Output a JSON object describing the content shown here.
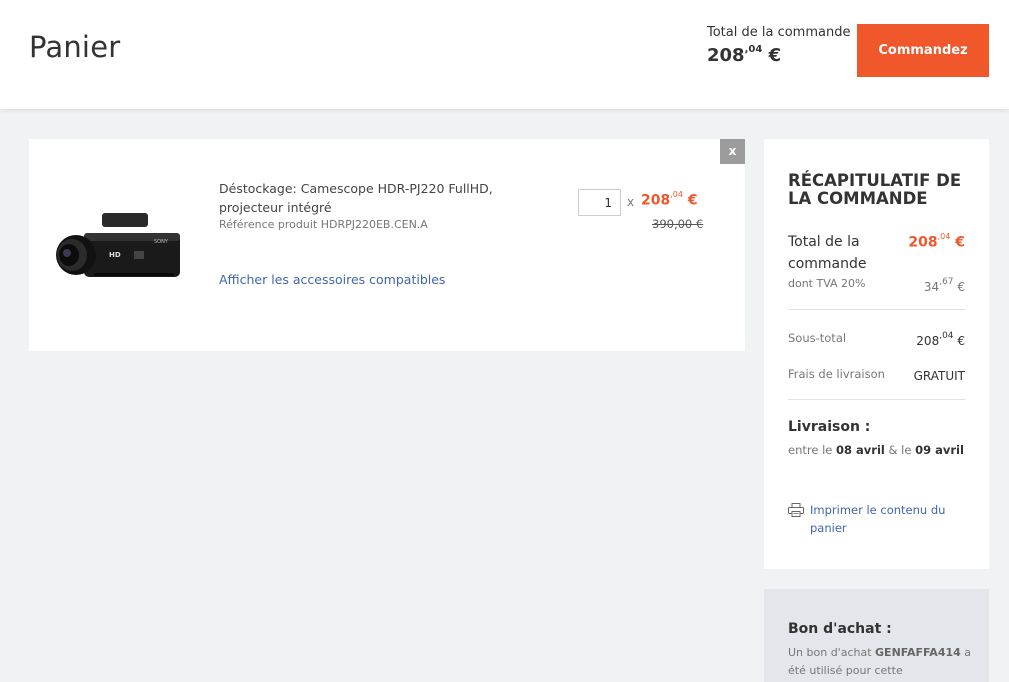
{
  "header": {
    "title": "Panier",
    "total_label": "Total de la commande",
    "total_int": "208",
    "total_dec": ",04",
    "total_currency": "€",
    "order_button": "Commandez"
  },
  "cart": {
    "remove_label": "x",
    "item": {
      "title": "Déstockage: Camescope HDR-PJ220 FullHD, projecteur intégré",
      "reference": "Référence produit HDRPJ220EB.CEN.A",
      "accessories_link": "Afficher les accessoires compatibles",
      "quantity": "1",
      "times": "x",
      "price_int": "208",
      "price_dec": ",04",
      "price_currency": "€",
      "old_price": "390,00 €"
    }
  },
  "summary": {
    "title": "RÉCAPITULATIF DE LA COMMANDE",
    "total_label": "Total de la commande",
    "total_int": "208",
    "total_dec": ",04",
    "total_currency": "€",
    "tva_label": "dont TVA 20%",
    "tva_int": "34",
    "tva_dec": ",67",
    "tva_currency": "€",
    "subtotal_label": "Sous-total",
    "subtotal_int": "208",
    "subtotal_dec": ",04",
    "subtotal_currency": "€",
    "shipping_label": "Frais de livraison",
    "shipping_value": "GRATUIT",
    "delivery_title": "Livraison :",
    "delivery_prefix": "entre le",
    "delivery_date1": "08 avril",
    "delivery_mid": "& le",
    "delivery_date2": "09 avril",
    "print_link": "Imprimer le contenu du panier"
  },
  "voucher": {
    "title": "Bon d'achat :",
    "text_prefix": "Un bon d'achat",
    "code": "GENFAFFA414",
    "text_suffix": "a été utilisé pour cette"
  },
  "colors": {
    "accent": "#f0572a",
    "link": "#3f66b0",
    "background": "#f1f2f4"
  }
}
